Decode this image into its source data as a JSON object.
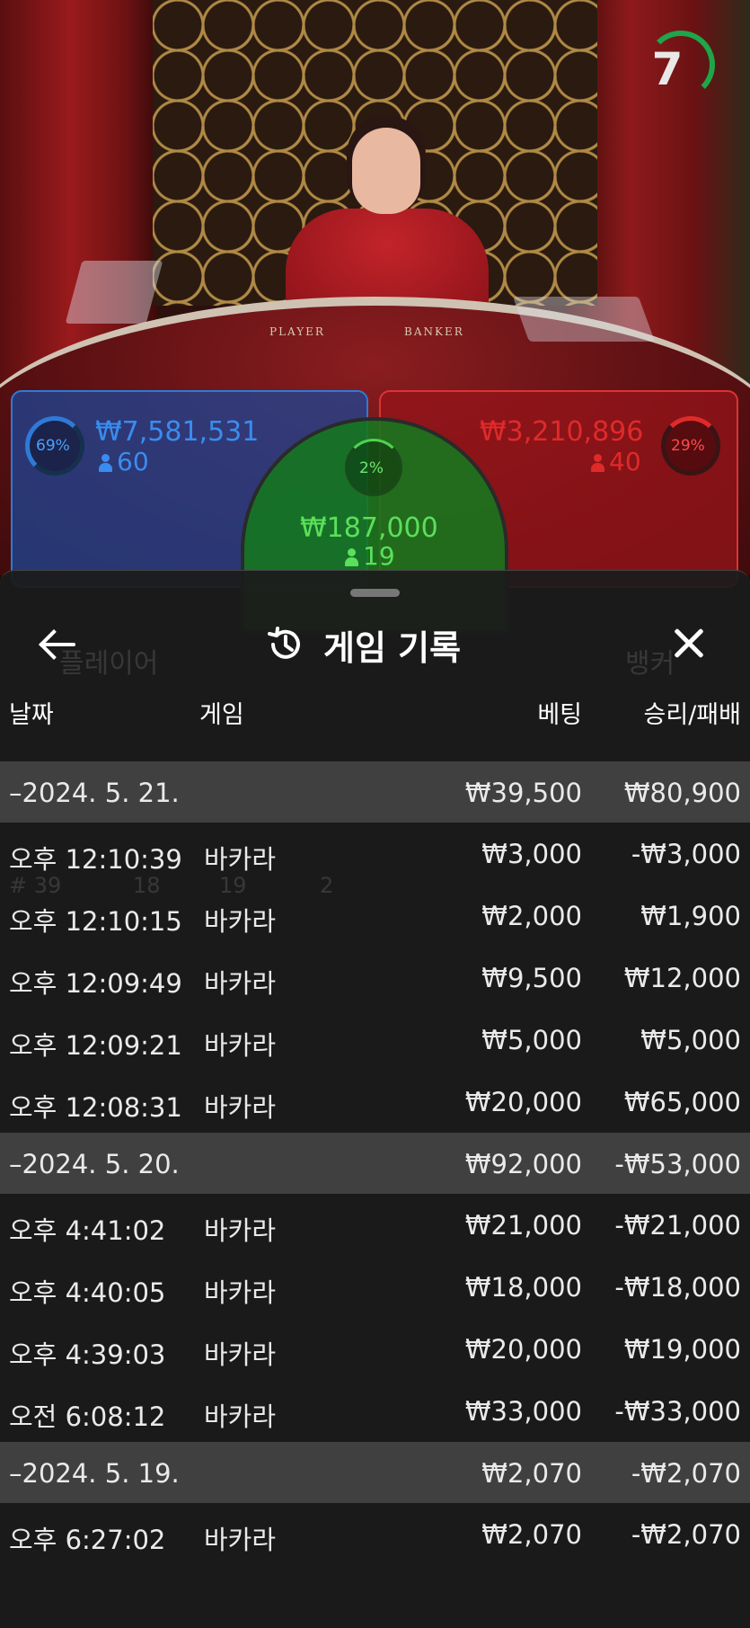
{
  "timer": {
    "value": "7"
  },
  "table": {
    "player_label": "PLAYER",
    "banker_label": "BANKER"
  },
  "bets": {
    "player": {
      "percent": "69%",
      "amount": "₩7,581,531",
      "players": "60",
      "color": "#2e7ad6"
    },
    "tie": {
      "percent": "2%",
      "amount": "₩187,000",
      "players": "19",
      "color": "#4fd24f"
    },
    "banker": {
      "percent": "29%",
      "amount": "₩3,210,896",
      "players": "40",
      "color": "#e02a2a"
    }
  },
  "background_labels": [
    "플레이어",
    "뱅커",
    "# 39",
    "18",
    "19",
    "2"
  ],
  "history": {
    "title": "게임 기록",
    "columns": {
      "date": "날짜",
      "game": "게임",
      "bet": "베팅",
      "result": "승리/패배"
    },
    "groups": [
      {
        "date": "–2024. 5. 21.",
        "bet": "₩39,500",
        "result": "₩80,900",
        "rows": [
          {
            "time": "오후 12:10:39",
            "game": "바카라",
            "bet": "₩3,000",
            "result": "-₩3,000"
          },
          {
            "time": "오후 12:10:15",
            "game": "바카라",
            "bet": "₩2,000",
            "result": "₩1,900"
          },
          {
            "time": "오후 12:09:49",
            "game": "바카라",
            "bet": "₩9,500",
            "result": "₩12,000"
          },
          {
            "time": "오후 12:09:21",
            "game": "바카라",
            "bet": "₩5,000",
            "result": "₩5,000"
          },
          {
            "time": "오후 12:08:31",
            "game": "바카라",
            "bet": "₩20,000",
            "result": "₩65,000"
          }
        ]
      },
      {
        "date": "–2024. 5. 20.",
        "bet": "₩92,000",
        "result": "-₩53,000",
        "rows": [
          {
            "time": "오후 4:41:02",
            "game": "바카라",
            "bet": "₩21,000",
            "result": "-₩21,000"
          },
          {
            "time": "오후 4:40:05",
            "game": "바카라",
            "bet": "₩18,000",
            "result": "-₩18,000"
          },
          {
            "time": "오후 4:39:03",
            "game": "바카라",
            "bet": "₩20,000",
            "result": "₩19,000"
          },
          {
            "time": "오전 6:08:12",
            "game": "바카라",
            "bet": "₩33,000",
            "result": "-₩33,000"
          }
        ]
      },
      {
        "date": "–2024. 5. 19.",
        "bet": "₩2,070",
        "result": "-₩2,070",
        "rows": [
          {
            "time": "오후 6:27:02",
            "game": "바카라",
            "bet": "₩2,070",
            "result": "-₩2,070"
          }
        ]
      }
    ]
  }
}
